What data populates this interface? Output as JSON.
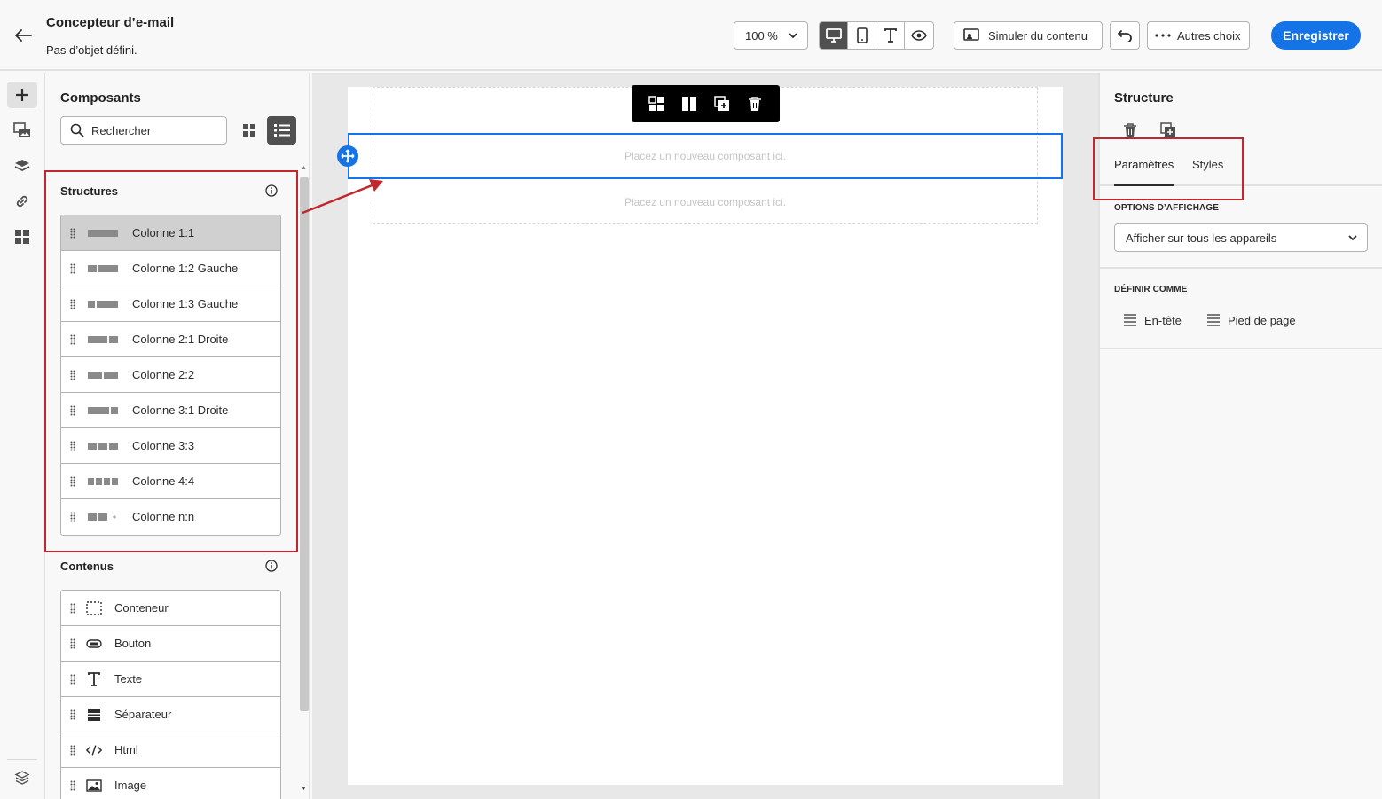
{
  "header": {
    "title": "Concepteur d’e-mail",
    "subtitle": "Pas d’objet défini.",
    "zoom": "100 %",
    "simulate_label": "Simuler du contenu",
    "more_label": "Autres choix",
    "save_label": "Enregistrer"
  },
  "components": {
    "title": "Composants",
    "search_placeholder": "Rechercher",
    "structures_title": "Structures",
    "structures": [
      {
        "label": "Colonne 1:1"
      },
      {
        "label": "Colonne 1:2 Gauche"
      },
      {
        "label": "Colonne 1:3 Gauche"
      },
      {
        "label": "Colonne 2:1 Droite"
      },
      {
        "label": "Colonne 2:2"
      },
      {
        "label": "Colonne 3:1 Droite"
      },
      {
        "label": "Colonne 3:3"
      },
      {
        "label": "Colonne 4:4"
      },
      {
        "label": "Colonne n:n"
      }
    ],
    "contents_title": "Contenus",
    "contents": [
      {
        "label": "Conteneur",
        "icon": "container-icon"
      },
      {
        "label": "Bouton",
        "icon": "button-icon"
      },
      {
        "label": "Texte",
        "icon": "text-icon"
      },
      {
        "label": "Séparateur",
        "icon": "divider-icon"
      },
      {
        "label": "Html",
        "icon": "code-icon"
      },
      {
        "label": "Image",
        "icon": "image-icon"
      }
    ]
  },
  "canvas": {
    "drop_placeholder": "Placez un nouveau composant ici.",
    "placeholder_2": "Placez un nouveau composant ici."
  },
  "properties": {
    "title": "Structure",
    "tab_params": "Paramètres",
    "tab_styles": "Styles",
    "display_options_label": "OPTIONS D’AFFICHAGE",
    "display_select_value": "Afficher sur tous les appareils",
    "define_as_label": "DÉFINIR COMME",
    "header_option": "En-tête",
    "footer_option": "Pied de page"
  },
  "colors": {
    "accent": "#1473e6",
    "annotation_red": "#c0282d"
  }
}
